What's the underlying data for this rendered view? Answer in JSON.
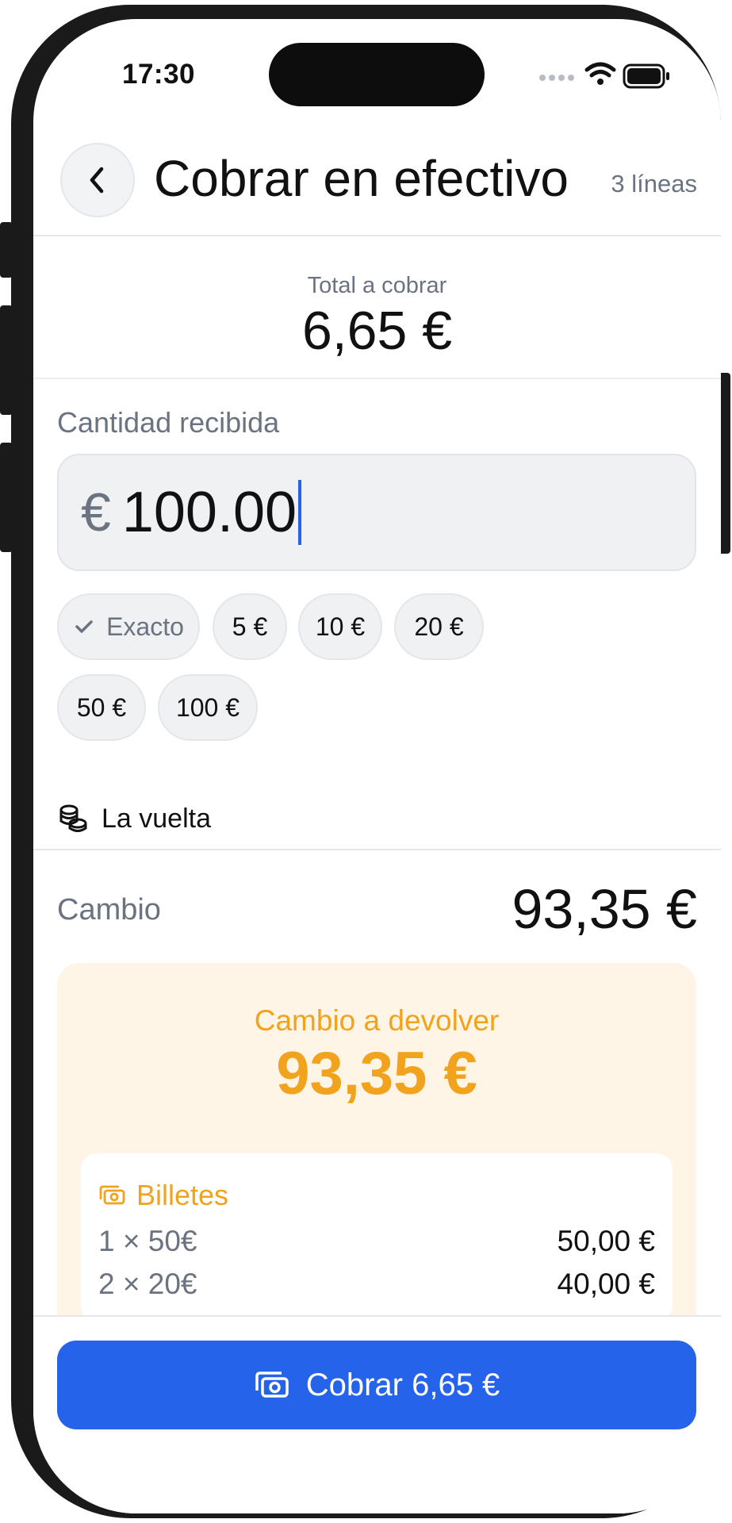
{
  "status_bar": {
    "time": "17:30"
  },
  "header": {
    "title": "Cobrar en efectivo",
    "subtitle": "3 líneas",
    "back_icon": "chevron-left-icon"
  },
  "total": {
    "label": "Total a cobrar",
    "value": "6,65 €"
  },
  "received": {
    "label": "Cantidad recibida",
    "currency_symbol": "€",
    "value": "100.00"
  },
  "quick_amounts": [
    {
      "label": "Exacto",
      "icon": "check-icon"
    },
    {
      "label": "5 €"
    },
    {
      "label": "10 €"
    },
    {
      "label": "20 €"
    },
    {
      "label": "50 €"
    },
    {
      "label": "100 €"
    }
  ],
  "vuelta": {
    "label": "La vuelta",
    "icon": "coins-icon"
  },
  "cambio": {
    "label": "Cambio",
    "value": "93,35 €"
  },
  "change_card": {
    "title": "Cambio a devolver",
    "value": "93,35 €",
    "bills": {
      "label": "Billetes",
      "icon": "banknote-icon",
      "rows": [
        {
          "qty": "1 × 50€",
          "amount": "50,00 €"
        },
        {
          "qty": "2 × 20€",
          "amount": "40,00 €"
        }
      ]
    }
  },
  "pay_button": {
    "label": "Cobrar 6,65 €",
    "icon": "banknote-icon"
  },
  "colors": {
    "accent": "#2563eb",
    "change": "#f2a31d",
    "change_bg": "#fef5e6"
  }
}
